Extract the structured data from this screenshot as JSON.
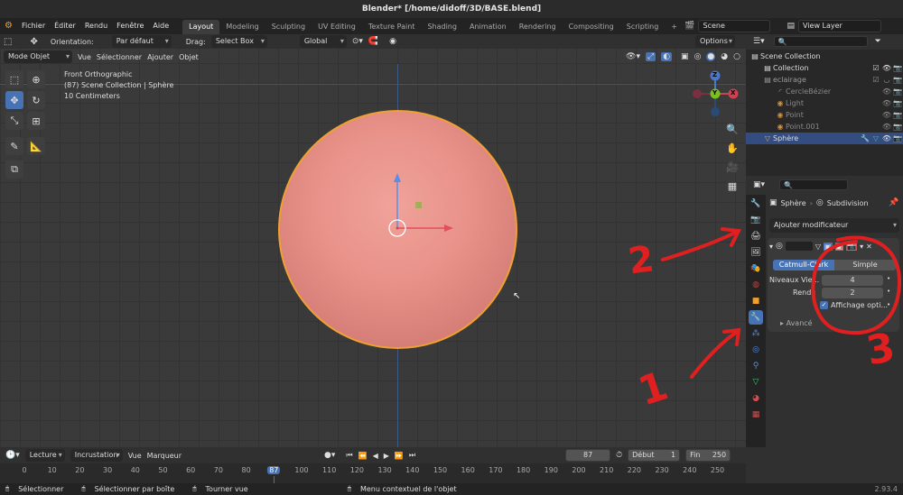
{
  "window": {
    "title": "Blender* [/home/didoff/3D/BASE.blend]"
  },
  "menu": {
    "items": [
      "Fichier",
      "Éditer",
      "Rendu",
      "Fenêtre",
      "Aide"
    ],
    "workspaces": [
      "Layout",
      "Modeling",
      "Sculpting",
      "UV Editing",
      "Texture Paint",
      "Shading",
      "Animation",
      "Rendering",
      "Compositing",
      "Scripting"
    ],
    "active_workspace": "Layout",
    "scene": "Scene",
    "view_layer": "View Layer"
  },
  "toolsettings": {
    "orientation_label": "Orientation:",
    "orientation_value": "Par défaut",
    "drag_label": "Drag:",
    "drag_value": "Select Box",
    "transform_value": "Global",
    "options_label": "Options"
  },
  "viewport_header": {
    "mode": "Mode Objet",
    "menus": [
      "Vue",
      "Sélectionner",
      "Ajouter",
      "Objet"
    ]
  },
  "viewport_overlay": {
    "line1": "Front Orthographic",
    "line2": "(87) Scene Collection | Sphère",
    "line3": "10 Centimeters"
  },
  "gizmo": {
    "z": "Z",
    "y": "Y",
    "x": "X"
  },
  "outliner": {
    "rows": [
      {
        "label": "Scene Collection",
        "indent": 0,
        "selected": false
      },
      {
        "label": "Collection",
        "indent": 1,
        "selected": false
      },
      {
        "label": "eclairage",
        "indent": 1,
        "selected": false
      },
      {
        "label": "CercleBézier",
        "indent": 2,
        "selected": false
      },
      {
        "label": "Light",
        "indent": 2,
        "selected": false
      },
      {
        "label": "Point",
        "indent": 2,
        "selected": false
      },
      {
        "label": "Point.001",
        "indent": 2,
        "selected": false
      },
      {
        "label": "Sphère",
        "indent": 1,
        "selected": true
      }
    ]
  },
  "properties": {
    "object_name": "Sphère",
    "modifier_name": "Subdivision",
    "add_modifier": "Ajouter modificateur",
    "catmull": "Catmull-Clark",
    "simple": "Simple",
    "levels_label": "Niveaux Vie...",
    "levels_value": "4",
    "render_label": "Rendu",
    "render_value": "2",
    "optimal_label": "Affichage opti...",
    "advanced_label": "Avancé"
  },
  "annotations": {
    "a1": "1",
    "a2": "2",
    "a3": "3"
  },
  "timeline": {
    "menus": [
      "Lecture",
      "Incrustation",
      "Vue",
      "Marqueur"
    ],
    "current_frame": "87",
    "start_label": "Début",
    "start_value": "1",
    "end_label": "Fin",
    "end_value": "250",
    "ticks": [
      "0",
      "10",
      "20",
      "30",
      "40",
      "50",
      "60",
      "70",
      "80",
      "87",
      "100",
      "110",
      "120",
      "130",
      "140",
      "150",
      "160",
      "170",
      "180",
      "190",
      "200",
      "210",
      "220",
      "230",
      "240",
      "250"
    ]
  },
  "status": {
    "select": "Sélectionner",
    "box_select": "Sélectionner par boîte",
    "rotate_view": "Tourner vue",
    "context_menu": "Menu contextuel de l'objet",
    "version": "2.93.4"
  },
  "colors": {
    "accent": "#4772b3",
    "sphere": "#e8928a",
    "outline": "#f0a030",
    "annotation": "#e02020"
  }
}
